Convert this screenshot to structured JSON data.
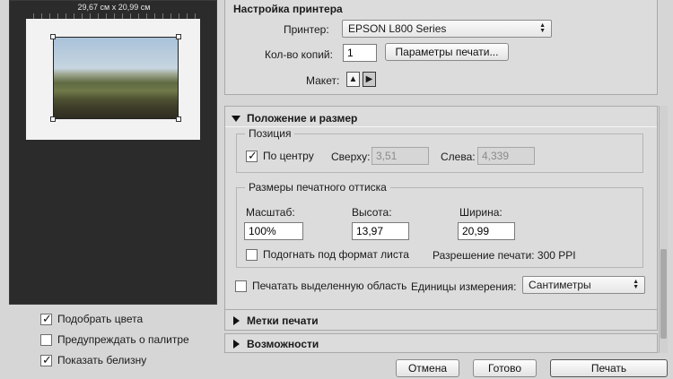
{
  "preview": {
    "paper_size": "29,67 см x 20,99 см"
  },
  "left_options": [
    {
      "label": "Подобрать цвета",
      "checked": true
    },
    {
      "label": "Предупреждать о палитре",
      "checked": false
    },
    {
      "label": "Показать белизну",
      "checked": true
    }
  ],
  "printer_setup": {
    "title": "Настройка принтера",
    "printer_label": "Принтер:",
    "printer_value": "EPSON L800 Series",
    "copies_label": "Кол-во копий:",
    "copies_value": "1",
    "print_settings_button": "Параметры печати...",
    "layout_label": "Макет:"
  },
  "position_size": {
    "title": "Положение и размер",
    "position_group": "Позиция",
    "center_label": "По центру",
    "center_checked": true,
    "top_label": "Сверху:",
    "top_value": "3,51",
    "left_label": "Слева:",
    "left_value": "4,339",
    "size_group": "Размеры печатного оттиска",
    "scale_label": "Масштаб:",
    "scale_value": "100%",
    "height_label": "Высота:",
    "height_value": "13,97",
    "width_label": "Ширина:",
    "width_value": "20,99",
    "fit_label": "Подогнать под формат листа",
    "fit_checked": false,
    "resolution_text": "Разрешение печати: 300 PPI",
    "print_selected_label": "Печатать выделенную область",
    "print_selected_checked": false,
    "units_label": "Единицы измерения:",
    "units_value": "Сантиметры"
  },
  "collapsed_sections": {
    "print_marks": "Метки печати",
    "features": "Возможности"
  },
  "buttons": {
    "cancel": "Отмена",
    "done": "Готово",
    "print": "Печать"
  }
}
